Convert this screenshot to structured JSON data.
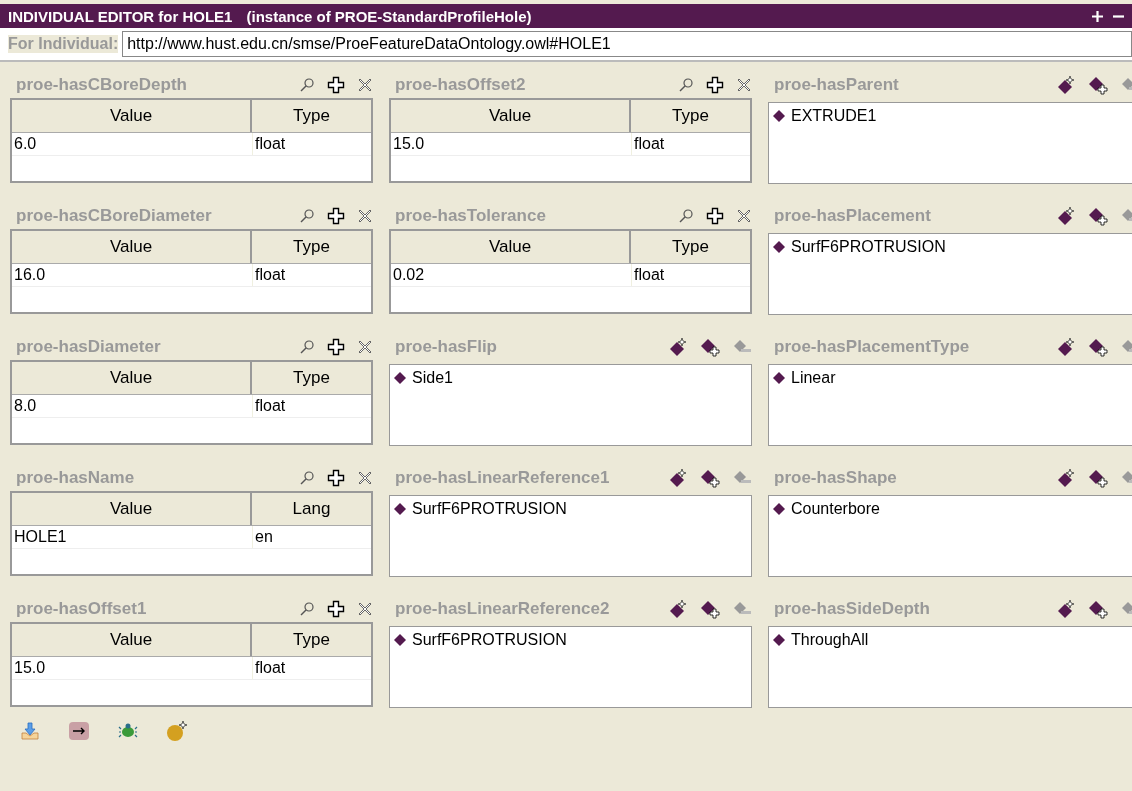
{
  "title_bar": {
    "title": "INDIVIDUAL EDITOR for HOLE1",
    "subtitle": "(instance of PROE-StandardProfileHole)"
  },
  "individual": {
    "label": "For Individual:",
    "value": "http://www.hust.edu.cn/smse/ProeFeatureDataOntology.owl#HOLE1"
  },
  "properties": [
    {
      "kind": "datatype",
      "name": "proe-hasCBoreDepth",
      "columns": [
        "Value",
        "Type"
      ],
      "rows": [
        [
          "6.0",
          "float"
        ]
      ]
    },
    {
      "kind": "datatype",
      "name": "proe-hasOffset2",
      "columns": [
        "Value",
        "Type"
      ],
      "rows": [
        [
          "15.0",
          "float"
        ]
      ]
    },
    {
      "kind": "object",
      "name": "proe-hasParent",
      "values": [
        "EXTRUDE1"
      ]
    },
    {
      "kind": "datatype",
      "name": "proe-hasCBoreDiameter",
      "columns": [
        "Value",
        "Type"
      ],
      "rows": [
        [
          "16.0",
          "float"
        ]
      ]
    },
    {
      "kind": "datatype",
      "name": "proe-hasTolerance",
      "columns": [
        "Value",
        "Type"
      ],
      "rows": [
        [
          "0.02",
          "float"
        ]
      ]
    },
    {
      "kind": "object",
      "name": "proe-hasPlacement",
      "values": [
        "SurfF6PROTRUSION"
      ]
    },
    {
      "kind": "datatype",
      "name": "proe-hasDiameter",
      "columns": [
        "Value",
        "Type"
      ],
      "rows": [
        [
          "8.0",
          "float"
        ]
      ]
    },
    {
      "kind": "object",
      "name": "proe-hasFlip",
      "values": [
        "Side1"
      ]
    },
    {
      "kind": "object",
      "name": "proe-hasPlacementType",
      "values": [
        "Linear"
      ]
    },
    {
      "kind": "datatype",
      "name": "proe-hasName",
      "columns": [
        "Value",
        "Lang"
      ],
      "rows": [
        [
          "HOLE1",
          "en"
        ]
      ]
    },
    {
      "kind": "object",
      "name": "proe-hasLinearReference1",
      "values": [
        "SurfF6PROTRUSION"
      ]
    },
    {
      "kind": "object",
      "name": "proe-hasShape",
      "values": [
        "Counterbore"
      ]
    },
    {
      "kind": "datatype",
      "name": "proe-hasOffset1",
      "columns": [
        "Value",
        "Type"
      ],
      "rows": [
        [
          "15.0",
          "float"
        ]
      ]
    },
    {
      "kind": "object",
      "name": "proe-hasLinearReference2",
      "values": [
        "SurfF6PROTRUSION"
      ]
    },
    {
      "kind": "object",
      "name": "proe-hasSideDepth",
      "values": [
        "ThroughAll"
      ]
    }
  ]
}
